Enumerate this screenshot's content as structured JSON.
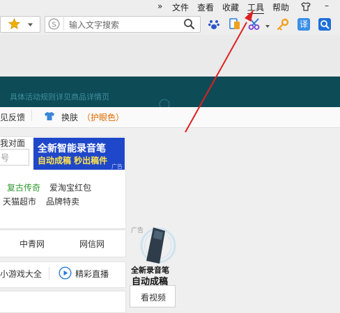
{
  "menu": {
    "chevron": "»",
    "items": [
      "文件",
      "查看",
      "收藏",
      "工具",
      "帮助"
    ],
    "skin_icon": "tshirt-icon",
    "minimize": "–"
  },
  "toolbar": {
    "search_placeholder": "输入文字搜索",
    "icons": [
      "star-icon",
      "dropdown-arrow",
      "search-engine-icon",
      "magnifier-icon",
      "paw-icon",
      "screenshot-icon",
      "scissors-icon",
      "key-icon",
      "translate-icon",
      "search-square-icon"
    ]
  },
  "banner": {
    "text": "具体活动规则详见商品详情页"
  },
  "strip": {
    "feedback": "见反馈",
    "skin": "换肤",
    "eye_care": "（护眼色）"
  },
  "left_panel": {
    "header_text": "我对面",
    "input_placeholder": "号"
  },
  "ad_banner": {
    "line1": "全新智能录音笔",
    "line2": "自动成稿 秒出稿件",
    "tag": "广告"
  },
  "links": {
    "row1": [
      "复古传奇",
      "爱淘宝红包"
    ],
    "row2": [
      "天猫超市",
      "品牌特卖"
    ],
    "row3": [
      "中青网",
      "网信网"
    ],
    "row4": [
      "小游戏大全",
      "精彩直播"
    ]
  },
  "side_ad": {
    "tag": "广告",
    "line1": "全新录音笔",
    "line2": "自动成稿",
    "button": "看视频"
  },
  "colors": {
    "banner_bg": "#0d4b57",
    "ad_blue": "#1f47c9",
    "eye_care": "#e06a00",
    "arrow": "#e02020",
    "link_green": "#2f9a2f"
  }
}
